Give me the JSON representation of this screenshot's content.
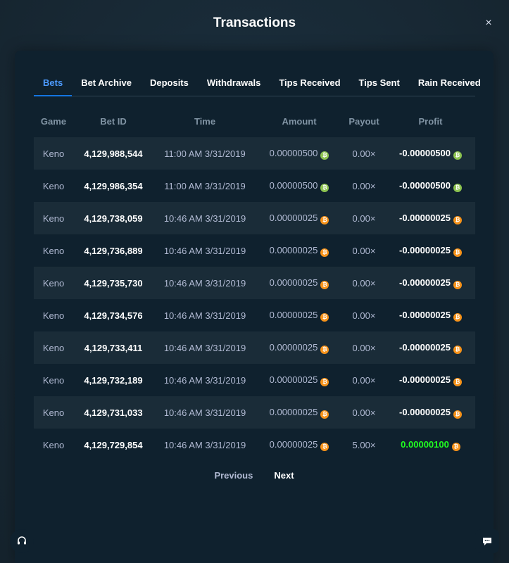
{
  "modal": {
    "title": "Transactions",
    "close_label": "×"
  },
  "tabs": [
    {
      "label": "Bets",
      "active": true
    },
    {
      "label": "Bet Archive"
    },
    {
      "label": "Deposits"
    },
    {
      "label": "Withdrawals"
    },
    {
      "label": "Tips Received"
    },
    {
      "label": "Tips Sent"
    },
    {
      "label": "Rain Received"
    }
  ],
  "table": {
    "headers": [
      "Game",
      "Bet ID",
      "Time",
      "Amount",
      "Payout",
      "Profit"
    ],
    "rows": [
      {
        "game": "Keno",
        "bet_id": "4,129,988,544",
        "time": "11:00 AM 3/31/2019",
        "amount": "0.00000500",
        "coin": "bch",
        "payout": "0.00×",
        "profit": "-0.00000500",
        "win": false
      },
      {
        "game": "Keno",
        "bet_id": "4,129,986,354",
        "time": "11:00 AM 3/31/2019",
        "amount": "0.00000500",
        "coin": "bch",
        "payout": "0.00×",
        "profit": "-0.00000500",
        "win": false
      },
      {
        "game": "Keno",
        "bet_id": "4,129,738,059",
        "time": "10:46 AM 3/31/2019",
        "amount": "0.00000025",
        "coin": "btc",
        "payout": "0.00×",
        "profit": "-0.00000025",
        "win": false
      },
      {
        "game": "Keno",
        "bet_id": "4,129,736,889",
        "time": "10:46 AM 3/31/2019",
        "amount": "0.00000025",
        "coin": "btc",
        "payout": "0.00×",
        "profit": "-0.00000025",
        "win": false
      },
      {
        "game": "Keno",
        "bet_id": "4,129,735,730",
        "time": "10:46 AM 3/31/2019",
        "amount": "0.00000025",
        "coin": "btc",
        "payout": "0.00×",
        "profit": "-0.00000025",
        "win": false
      },
      {
        "game": "Keno",
        "bet_id": "4,129,734,576",
        "time": "10:46 AM 3/31/2019",
        "amount": "0.00000025",
        "coin": "btc",
        "payout": "0.00×",
        "profit": "-0.00000025",
        "win": false
      },
      {
        "game": "Keno",
        "bet_id": "4,129,733,411",
        "time": "10:46 AM 3/31/2019",
        "amount": "0.00000025",
        "coin": "btc",
        "payout": "0.00×",
        "profit": "-0.00000025",
        "win": false
      },
      {
        "game": "Keno",
        "bet_id": "4,129,732,189",
        "time": "10:46 AM 3/31/2019",
        "amount": "0.00000025",
        "coin": "btc",
        "payout": "0.00×",
        "profit": "-0.00000025",
        "win": false
      },
      {
        "game": "Keno",
        "bet_id": "4,129,731,033",
        "time": "10:46 AM 3/31/2019",
        "amount": "0.00000025",
        "coin": "btc",
        "payout": "0.00×",
        "profit": "-0.00000025",
        "win": false
      },
      {
        "game": "Keno",
        "bet_id": "4,129,729,854",
        "time": "10:46 AM 3/31/2019",
        "amount": "0.00000025",
        "coin": "btc",
        "payout": "5.00×",
        "profit": "0.00000100",
        "win": true
      }
    ]
  },
  "pagination": {
    "previous_label": "Previous",
    "next_label": "Next"
  },
  "icons": {
    "close": "close-icon",
    "support": "headset-icon",
    "chat": "chat-icon",
    "btc": "bitcoin-icon",
    "bch": "bitcoin-cash-icon"
  },
  "colors": {
    "active_tab": "#1475e1",
    "win_profit": "#1fff20",
    "btc_coin": "#f7931a",
    "bch_coin": "#8dc351"
  }
}
